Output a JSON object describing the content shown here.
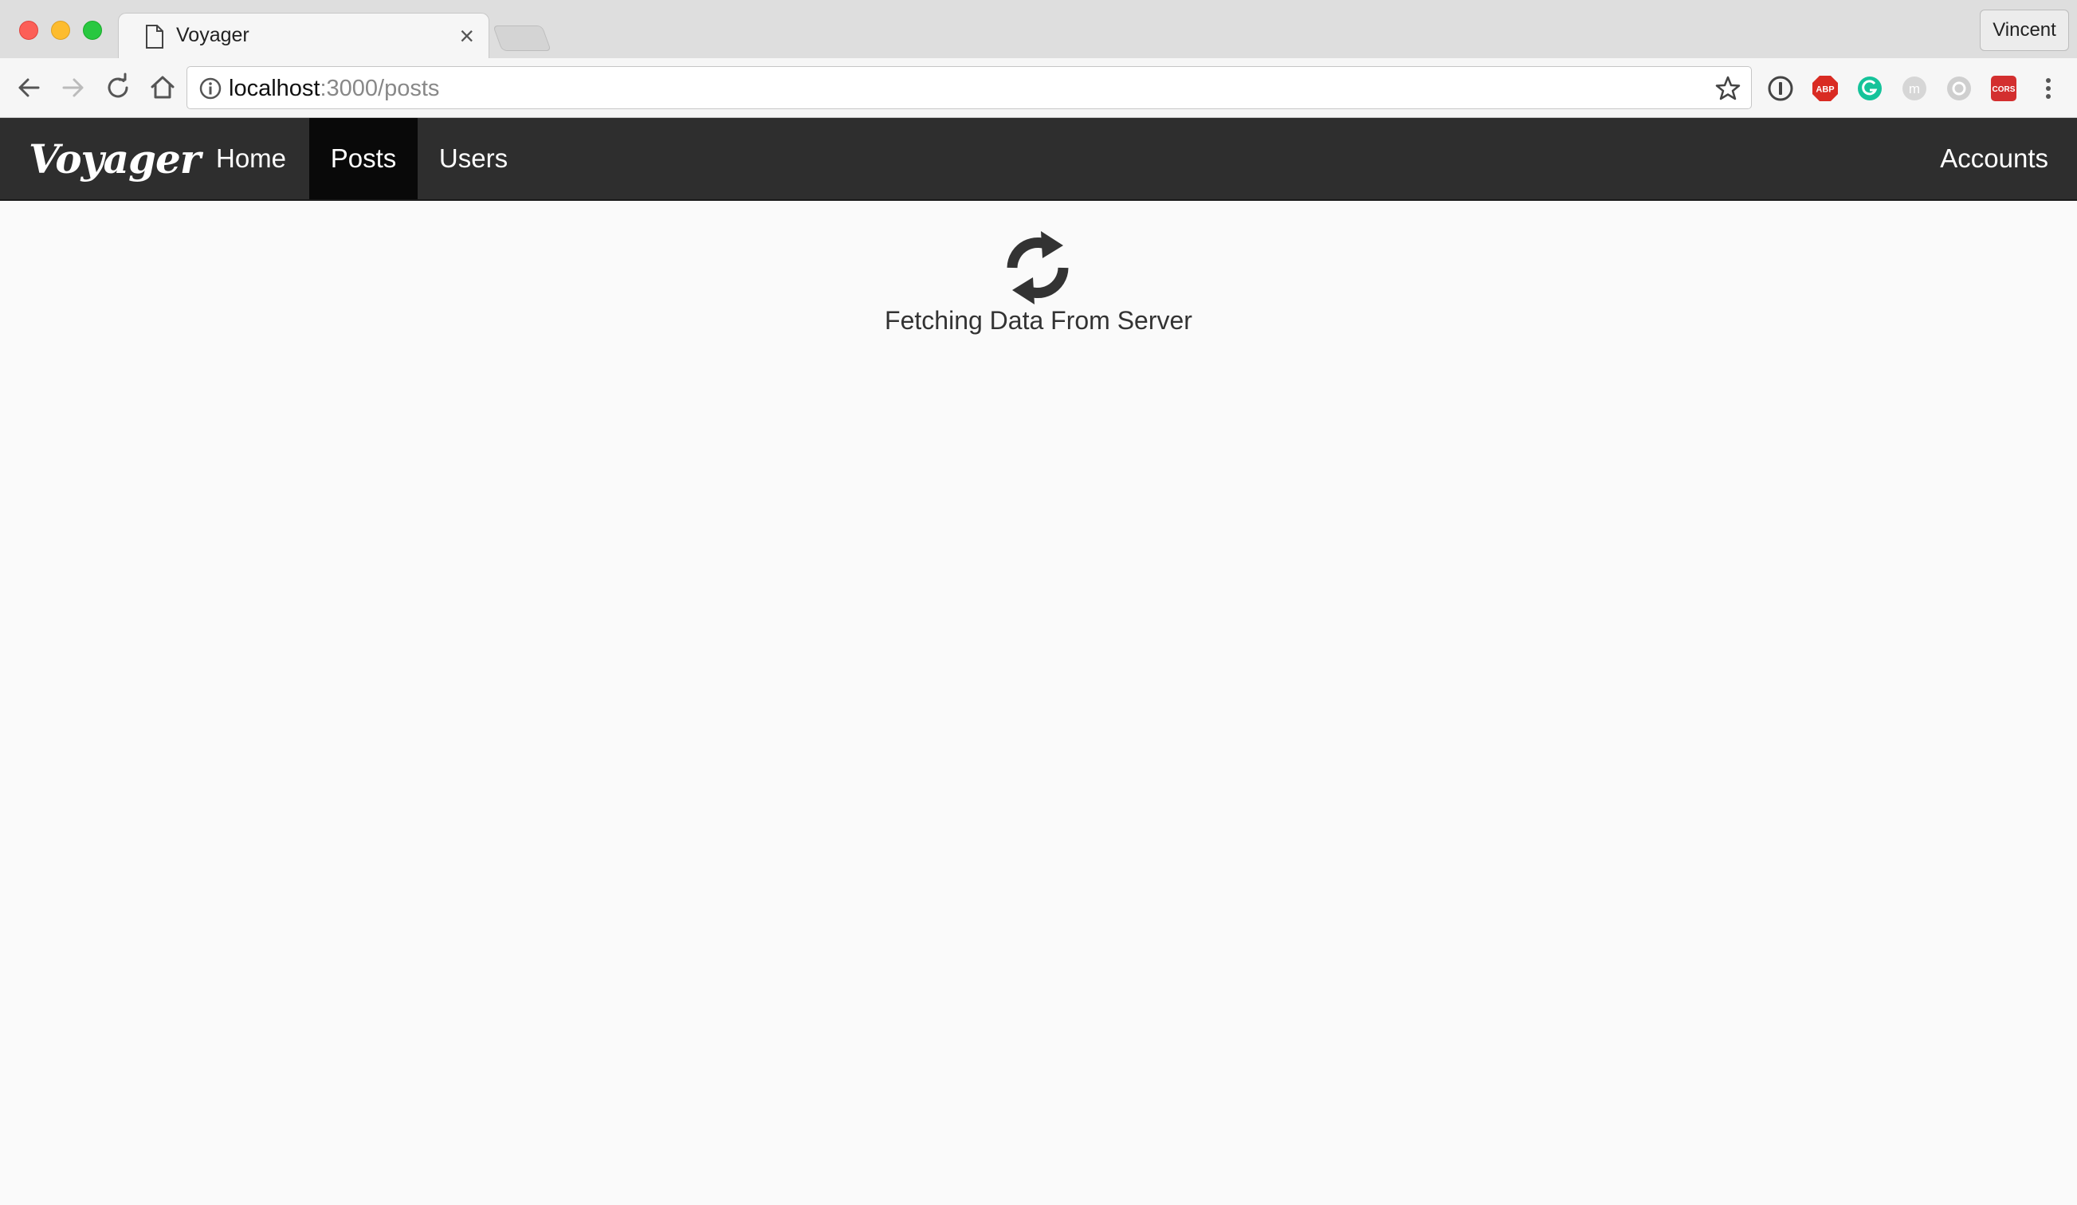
{
  "browser": {
    "tab_title": "Voyager",
    "profile_name": "Vincent",
    "url_host": "localhost",
    "url_path": ":3000/posts",
    "extensions": [
      "1password-icon",
      "adblock-plus-icon",
      "grammarly-icon",
      "m-extension-icon",
      "a-extension-icon",
      "cors-icon"
    ],
    "extension_labels": {
      "abp": "ABP",
      "cors": "CORS"
    }
  },
  "navbar": {
    "brand": "Voyager",
    "links": [
      {
        "label": "Home",
        "active": false
      },
      {
        "label": "Posts",
        "active": true
      },
      {
        "label": "Users",
        "active": false
      }
    ],
    "right_link": "Accounts"
  },
  "main": {
    "status_icon": "refresh-icon",
    "status_text": "Fetching Data From Server"
  },
  "colors": {
    "navbar_bg": "#2e2e2e",
    "active_link_bg": "#090909",
    "page_bg": "#fafafa",
    "icon": "#333333"
  }
}
